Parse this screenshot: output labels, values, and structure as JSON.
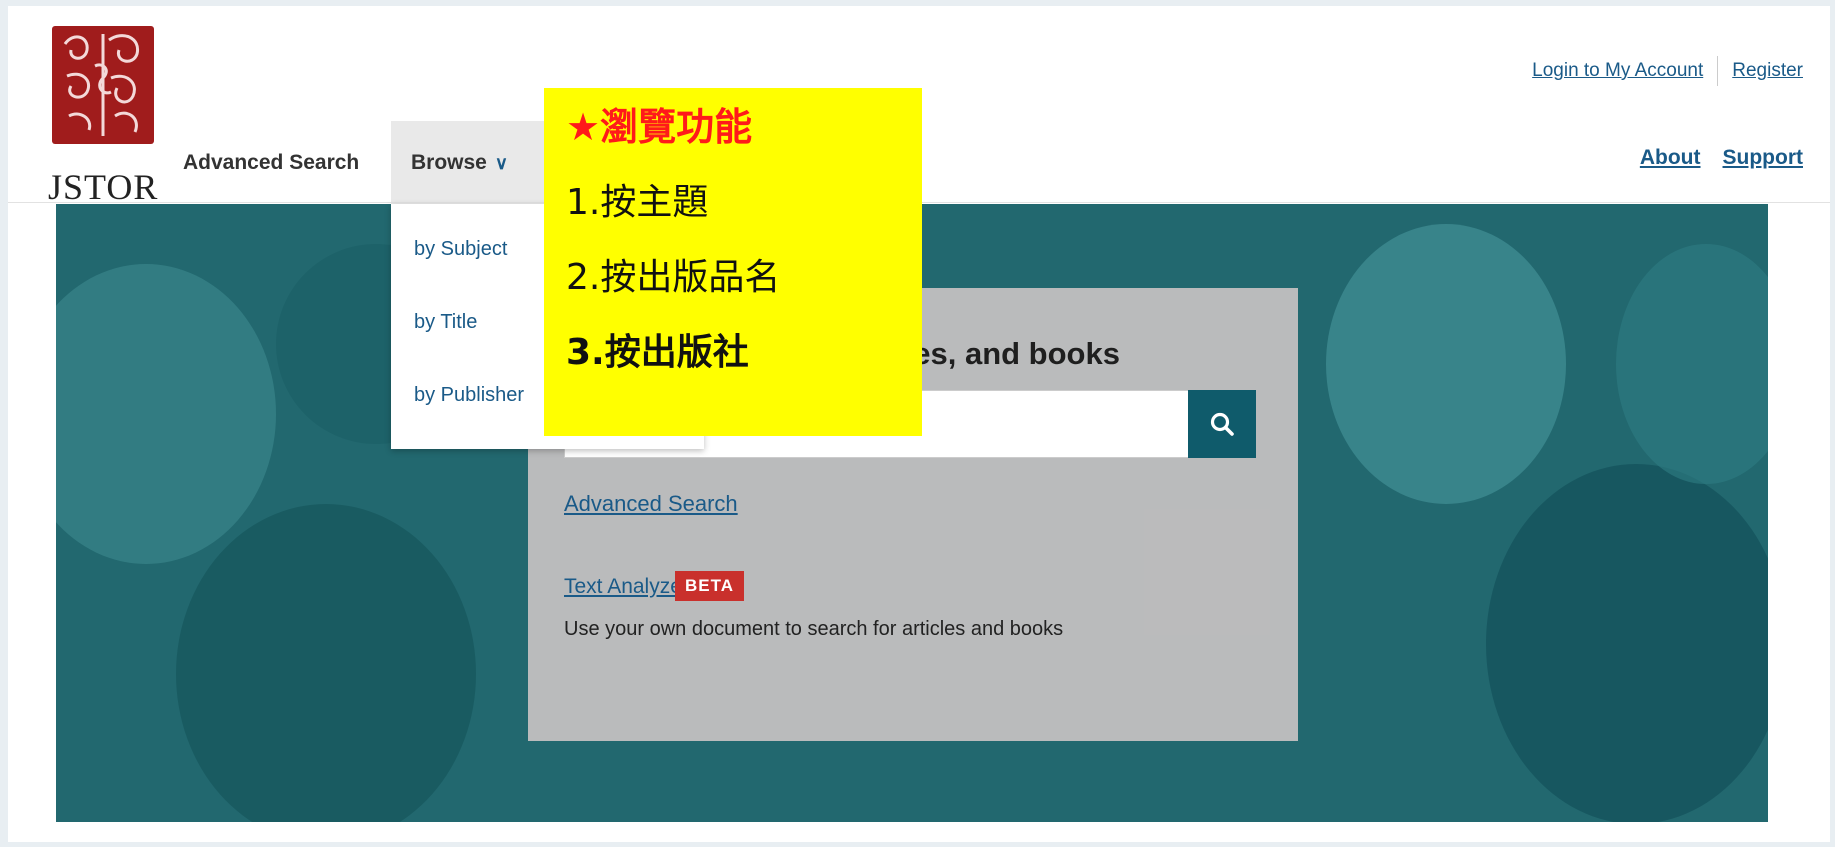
{
  "header": {
    "logo_text": "JSTOR",
    "nav": {
      "advanced_search": "Advanced Search",
      "browse": "Browse"
    },
    "top_links": {
      "login": "Login to My Account",
      "register": "Register"
    },
    "right_nav": {
      "about": "About",
      "support": "Support"
    }
  },
  "browse_menu": {
    "items": [
      {
        "label": "by Subject"
      },
      {
        "label": "by Title"
      },
      {
        "label": "by Publisher"
      }
    ]
  },
  "hero": {
    "heading_visible": "ces, and books",
    "search": {
      "button_icon": "search-icon",
      "value": ""
    },
    "advanced_search_link": "Advanced Search",
    "text_analyzer": {
      "label": "Text Analyzer",
      "badge": "BETA",
      "description": "Use your own document to search for articles and books"
    }
  },
  "annotation": {
    "title": "★瀏覽功能",
    "lines": [
      "1.按主題",
      "2.按出版品名",
      "3.按出版社"
    ]
  },
  "colors": {
    "accent_link": "#1a5a88",
    "logo_red": "#a01c1c",
    "hero_teal": "#22686f",
    "search_button": "#0f5b6b",
    "beta_badge": "#c9302c",
    "annotation_bg": "#ffff00",
    "annotation_title": "#ff1a1a"
  }
}
